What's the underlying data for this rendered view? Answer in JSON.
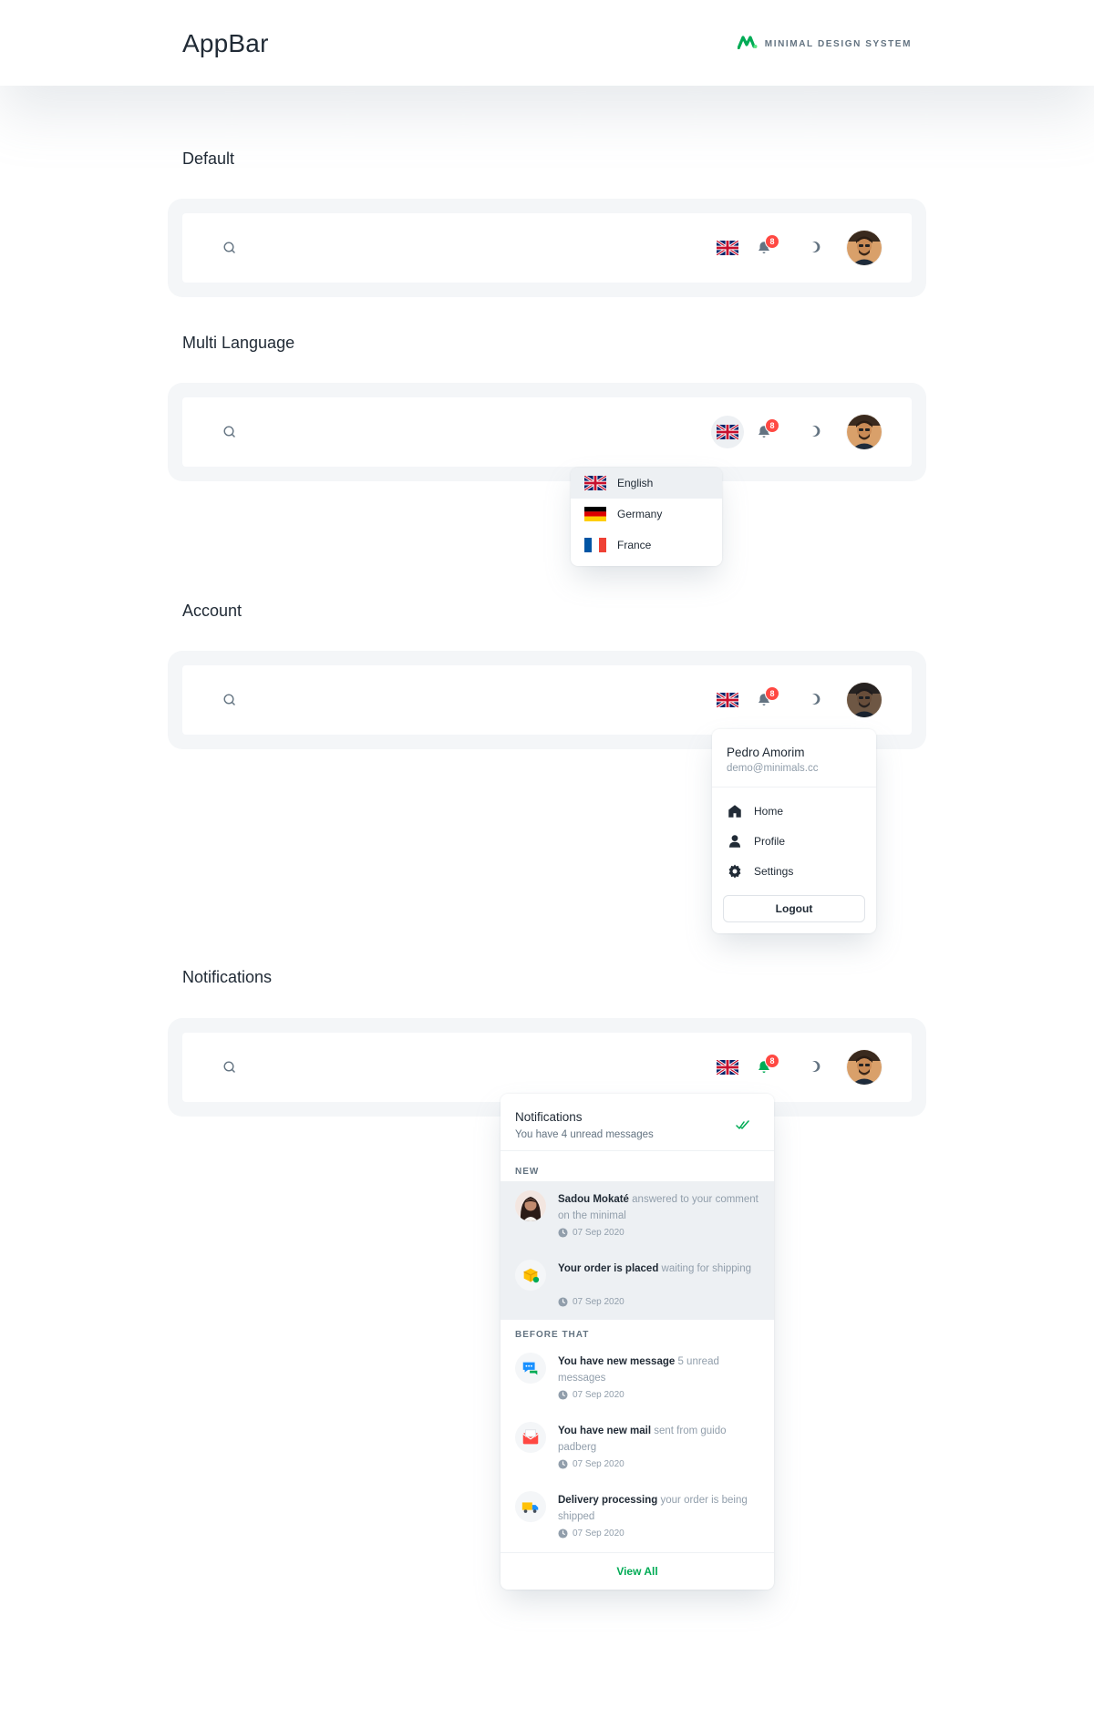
{
  "header": {
    "title": "AppBar",
    "brand_text": "MINIMAL DESIGN SYSTEM",
    "brand_color": "#00ab55"
  },
  "sections": {
    "default": "Default",
    "multi_language": "Multi Language",
    "account": "Account",
    "notifications": "Notifications"
  },
  "appbar": {
    "notification_count": "8",
    "icons": [
      "search-icon",
      "uk-flag-icon",
      "bell-icon",
      "moon-icon",
      "avatar"
    ]
  },
  "languages": [
    {
      "label": "English",
      "flag": "uk-flag-icon",
      "selected": true
    },
    {
      "label": "Germany",
      "flag": "germany-flag-icon",
      "selected": false
    },
    {
      "label": "France",
      "flag": "france-flag-icon",
      "selected": false
    }
  ],
  "account": {
    "name": "Pedro Amorim",
    "email": "demo@minimals.cc",
    "menu": [
      {
        "label": "Home",
        "icon": "home-icon"
      },
      {
        "label": "Profile",
        "icon": "person-icon"
      },
      {
        "label": "Settings",
        "icon": "gear-icon"
      }
    ],
    "logout": "Logout"
  },
  "notifications": {
    "title": "Notifications",
    "subtitle": "You have 4 unread messages",
    "new_label": "NEW",
    "before_label": "BEFORE THAT",
    "view_all": "View All",
    "new_items": [
      {
        "title": "Sadou Mokaté",
        "desc": " answered to your comment on the minimal",
        "time": "07 Sep 2020",
        "icon": "avatar"
      },
      {
        "title": "Your order is placed",
        "desc": " waiting for shipping",
        "time": "07 Sep 2020",
        "icon": "package-icon"
      }
    ],
    "old_items": [
      {
        "title": "You have new message",
        "desc": " 5 unread messages",
        "time": "07 Sep 2020",
        "icon": "chat-icon"
      },
      {
        "title": "You have new mail",
        "desc": " sent from guido padberg",
        "time": "07 Sep 2020",
        "icon": "mail-icon"
      },
      {
        "title": "Delivery processing",
        "desc": " your order is being shipped",
        "time": "07 Sep 2020",
        "icon": "truck-icon"
      }
    ]
  },
  "colors": {
    "badge": "#ff4842",
    "accent": "#00ab55",
    "bar_background": "#f4f6f8"
  }
}
